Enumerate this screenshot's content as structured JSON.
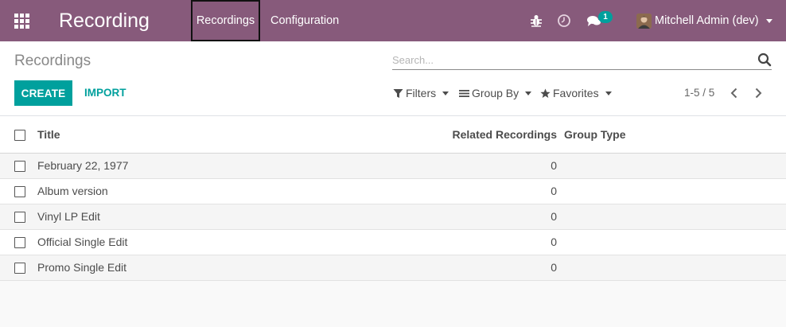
{
  "navbar": {
    "app_title": "Recording",
    "menus": [
      "Recordings",
      "Configuration"
    ],
    "chat_badge": "1",
    "user_name": "Mitchell Admin (dev)",
    "color": "#875a7b"
  },
  "control": {
    "breadcrumb": "Recordings",
    "search_placeholder": "Search...",
    "create_label": "CREATE",
    "import_label": "IMPORT",
    "filters_label": "Filters",
    "groupby_label": "Group By",
    "favorites_label": "Favorites",
    "pager": "1-5 / 5",
    "accent": "#00a09d"
  },
  "table": {
    "columns": [
      "Title",
      "Related Recordings",
      "Group Type"
    ],
    "rows": [
      {
        "title": "February 22, 1977",
        "related": "0",
        "group_type": ""
      },
      {
        "title": "Album version",
        "related": "0",
        "group_type": ""
      },
      {
        "title": "Vinyl LP Edit",
        "related": "0",
        "group_type": ""
      },
      {
        "title": "Official Single Edit",
        "related": "0",
        "group_type": ""
      },
      {
        "title": "Promo Single Edit",
        "related": "0",
        "group_type": ""
      }
    ]
  },
  "icons": [
    "apps-grid-icon",
    "bug-icon",
    "clock-icon",
    "chat-icon",
    "search-icon",
    "filter-icon",
    "list-icon",
    "star-icon",
    "chevron-left-icon",
    "chevron-right-icon"
  ]
}
